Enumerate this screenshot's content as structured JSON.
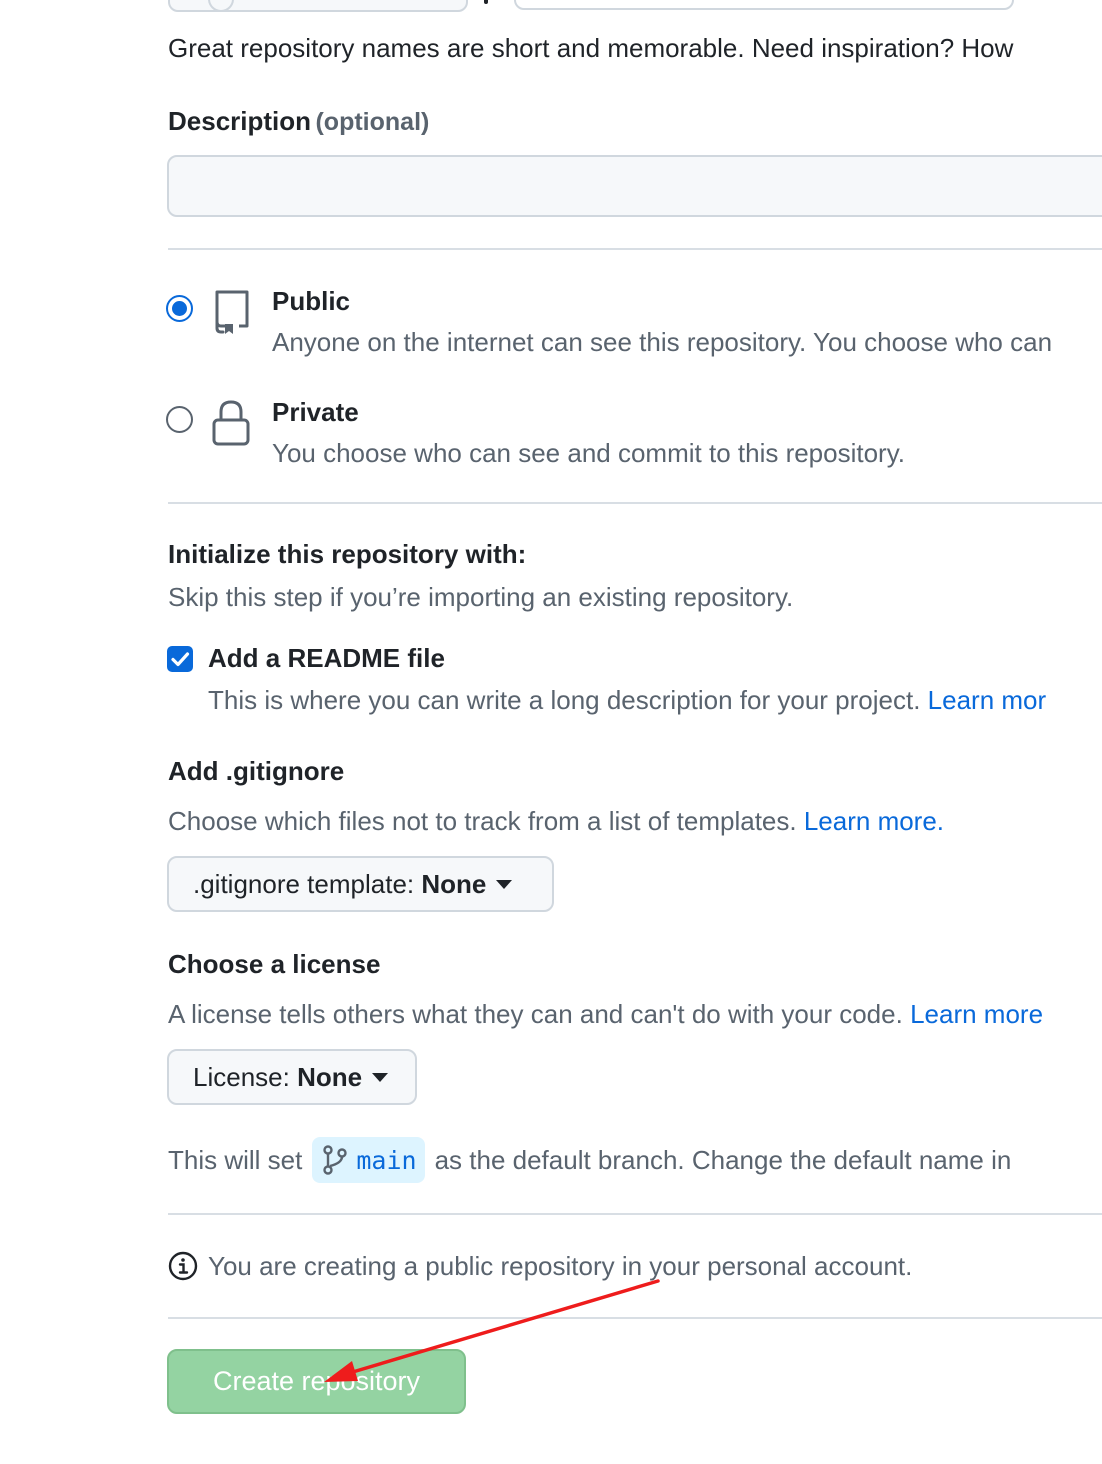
{
  "repository_name": {
    "hint": "Great repository names are short and memorable. Need inspiration? How"
  },
  "description": {
    "label": "Description",
    "optional_label": "(optional)",
    "value": "",
    "placeholder": ""
  },
  "visibility": {
    "selected": "public",
    "options": [
      {
        "id": "public",
        "title": "Public",
        "description": "Anyone on the internet can see this repository. You choose who can",
        "icon": "repo-icon",
        "checked": true
      },
      {
        "id": "private",
        "title": "Private",
        "description": "You choose who can see and commit to this repository.",
        "icon": "lock-icon",
        "checked": false
      }
    ]
  },
  "initialize": {
    "title": "Initialize this repository with:",
    "subtitle": "Skip this step if you’re importing an existing repository.",
    "readme": {
      "label": "Add a README file",
      "description": "This is where you can write a long description for your project.",
      "link": "Learn mor",
      "checked": true
    }
  },
  "gitignore": {
    "title": "Add .gitignore",
    "description": "Choose which files not to track from a list of templates.",
    "link": "Learn more.",
    "button_prefix": ".gitignore template:",
    "button_value": "None"
  },
  "license": {
    "title": "Choose a license",
    "description": "A license tells others what they can and can't do with your code.",
    "link": "Learn more",
    "button_prefix": "License:",
    "button_value": "None"
  },
  "branch": {
    "prefix": "This will set",
    "name": "main",
    "suffix": "as the default branch. Change the default name in"
  },
  "notice": {
    "text": "You are creating a public repository in your personal account.",
    "icon": "info-icon"
  },
  "submit": {
    "label": "Create repository",
    "enabled": false
  },
  "colors": {
    "accent": "#0969da",
    "muted_text": "#59636e",
    "submit_bg": "#94d3a2",
    "annotation_arrow": "#ee1c1c"
  }
}
